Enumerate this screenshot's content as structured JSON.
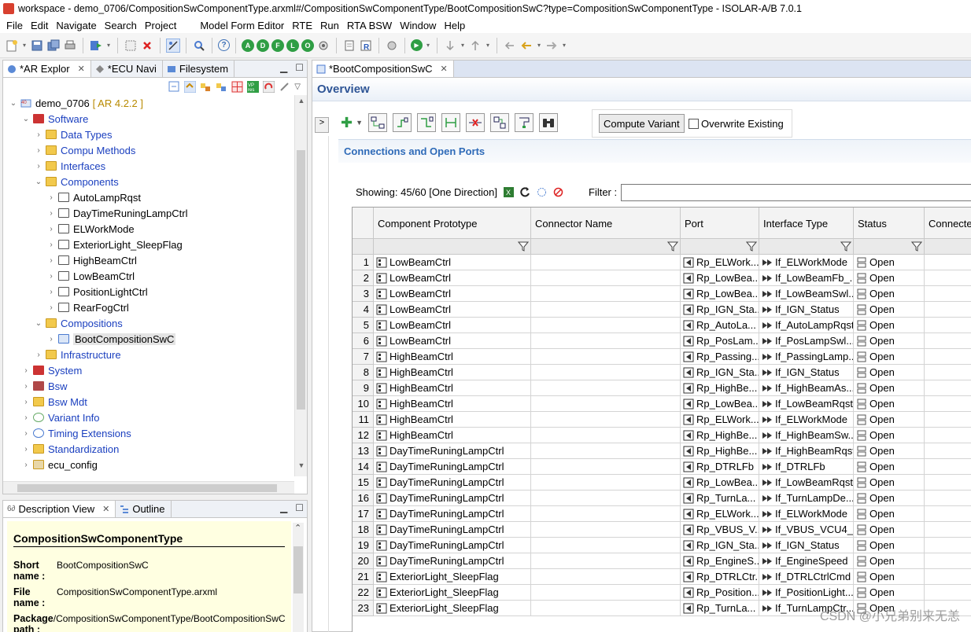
{
  "window_title": "workspace - demo_0706/CompositionSwComponentType.arxml#/CompositionSwComponentType/BootCompositionSwC?type=CompositionSwComponentType - ISOLAR-A/B 7.0.1",
  "menu": [
    "File",
    "Edit",
    "Navigate",
    "Search",
    "Project",
    "Model Form Editor",
    "RTE",
    "Run",
    "RTA BSW",
    "Window",
    "Help"
  ],
  "toolbar_letters": [
    "A",
    "D",
    "F",
    "L",
    "O"
  ],
  "left_tabs": [
    {
      "label": "*AR Explor",
      "close": "✕"
    },
    {
      "label": "*ECU Navi"
    },
    {
      "label": "Filesystem"
    }
  ],
  "tree": {
    "root": {
      "label": "demo_0706",
      "version": "[ AR 4.2.2 ]"
    },
    "items": [
      {
        "label": "Software"
      },
      {
        "label": "Data Types"
      },
      {
        "label": "Compu Methods"
      },
      {
        "label": "Interfaces"
      },
      {
        "label": "Components"
      },
      {
        "label": "AutoLampRqst"
      },
      {
        "label": "DayTimeRuningLampCtrl"
      },
      {
        "label": "ELWorkMode"
      },
      {
        "label": "ExteriorLight_SleepFlag"
      },
      {
        "label": "HighBeamCtrl"
      },
      {
        "label": "LowBeamCtrl"
      },
      {
        "label": "PositionLightCtrl"
      },
      {
        "label": "RearFogCtrl"
      },
      {
        "label": "Compositions"
      },
      {
        "label": "BootCompositionSwC"
      },
      {
        "label": "Infrastructure"
      },
      {
        "label": "System"
      },
      {
        "label": "Bsw"
      },
      {
        "label": "Bsw Mdt"
      },
      {
        "label": "Variant Info"
      },
      {
        "label": "Timing Extensions"
      },
      {
        "label": "Standardization"
      },
      {
        "label": "ecu_config"
      }
    ]
  },
  "desc_tabs": [
    {
      "label": "Description View",
      "close": "✕"
    },
    {
      "label": "Outline"
    }
  ],
  "description": {
    "title": "CompositionSwComponentType",
    "rows": [
      {
        "key": "Short name :",
        "value": "BootCompositionSwC"
      },
      {
        "key": "File name :",
        "value": "CompositionSwComponentType.arxml"
      },
      {
        "key": "Package path :",
        "value": "/CompositionSwComponentType/BootCompositionSwC"
      }
    ]
  },
  "editor": {
    "tab": {
      "label": "*BootCompositionSwC",
      "close": "✕"
    },
    "overview": "Overview",
    "collapse": ">",
    "compute_variant": "Compute Variant",
    "overwrite_existing": "Overwrite Existing",
    "section": "Connections and Open Ports",
    "showing": "Showing: 45/60 [One Direction]",
    "filter_label": "Filter :",
    "filter_value": ""
  },
  "table": {
    "columns": [
      "Component Prototype",
      "Connector Name",
      "Port",
      "Interface Type",
      "Status",
      "Connecte"
    ],
    "rows": [
      {
        "n": "1",
        "comp": "LowBeamCtrl",
        "conn": "",
        "port": "Rp_ELWork...",
        "iface": "If_ELWorkMode",
        "status": "Open"
      },
      {
        "n": "2",
        "comp": "LowBeamCtrl",
        "conn": "",
        "port": "Rp_LowBea...",
        "iface": "If_LowBeamFb_...",
        "status": "Open"
      },
      {
        "n": "3",
        "comp": "LowBeamCtrl",
        "conn": "",
        "port": "Rp_LowBea...",
        "iface": "If_LowBeamSwl...",
        "status": "Open"
      },
      {
        "n": "4",
        "comp": "LowBeamCtrl",
        "conn": "",
        "port": "Rp_IGN_Sta...",
        "iface": "If_IGN_Status",
        "status": "Open"
      },
      {
        "n": "5",
        "comp": "LowBeamCtrl",
        "conn": "",
        "port": "Rp_AutoLa...",
        "iface": "If_AutoLampRqst",
        "status": "Open"
      },
      {
        "n": "6",
        "comp": "LowBeamCtrl",
        "conn": "",
        "port": "Rp_PosLam...",
        "iface": "If_PosLampSwl...",
        "status": "Open"
      },
      {
        "n": "7",
        "comp": "HighBeamCtrl",
        "conn": "",
        "port": "Rp_Passing...",
        "iface": "If_PassingLamp...",
        "status": "Open"
      },
      {
        "n": "8",
        "comp": "HighBeamCtrl",
        "conn": "",
        "port": "Rp_IGN_Sta...",
        "iface": "If_IGN_Status",
        "status": "Open"
      },
      {
        "n": "9",
        "comp": "HighBeamCtrl",
        "conn": "",
        "port": "Rp_HighBe...",
        "iface": "If_HighBeamAs...",
        "status": "Open"
      },
      {
        "n": "10",
        "comp": "HighBeamCtrl",
        "conn": "",
        "port": "Rp_LowBea...",
        "iface": "If_LowBeamRqst",
        "status": "Open"
      },
      {
        "n": "11",
        "comp": "HighBeamCtrl",
        "conn": "",
        "port": "Rp_ELWork...",
        "iface": "If_ELWorkMode",
        "status": "Open"
      },
      {
        "n": "12",
        "comp": "HighBeamCtrl",
        "conn": "",
        "port": "Rp_HighBe...",
        "iface": "If_HighBeamSw...",
        "status": "Open"
      },
      {
        "n": "13",
        "comp": "DayTimeRuningLampCtrl",
        "conn": "",
        "port": "Rp_HighBe...",
        "iface": "If_HighBeamRqst",
        "status": "Open"
      },
      {
        "n": "14",
        "comp": "DayTimeRuningLampCtrl",
        "conn": "",
        "port": "Rp_DTRLFb",
        "iface": "If_DTRLFb",
        "status": "Open"
      },
      {
        "n": "15",
        "comp": "DayTimeRuningLampCtrl",
        "conn": "",
        "port": "Rp_LowBea...",
        "iface": "If_LowBeamRqst",
        "status": "Open"
      },
      {
        "n": "16",
        "comp": "DayTimeRuningLampCtrl",
        "conn": "",
        "port": "Rp_TurnLa...",
        "iface": "If_TurnLampDe...",
        "status": "Open"
      },
      {
        "n": "17",
        "comp": "DayTimeRuningLampCtrl",
        "conn": "",
        "port": "Rp_ELWork...",
        "iface": "If_ELWorkMode",
        "status": "Open"
      },
      {
        "n": "18",
        "comp": "DayTimeRuningLampCtrl",
        "conn": "",
        "port": "Rp_VBUS_V...",
        "iface": "If_VBUS_VCU4_...",
        "status": "Open"
      },
      {
        "n": "19",
        "comp": "DayTimeRuningLampCtrl",
        "conn": "",
        "port": "Rp_IGN_Sta...",
        "iface": "If_IGN_Status",
        "status": "Open"
      },
      {
        "n": "20",
        "comp": "DayTimeRuningLampCtrl",
        "conn": "",
        "port": "Rp_EngineS...",
        "iface": "If_EngineSpeed",
        "status": "Open"
      },
      {
        "n": "21",
        "comp": "ExteriorLight_SleepFlag",
        "conn": "",
        "port": "Rp_DTRLCtr...",
        "iface": "If_DTRLCtrlCmd",
        "status": "Open"
      },
      {
        "n": "22",
        "comp": "ExteriorLight_SleepFlag",
        "conn": "",
        "port": "Rp_Position...",
        "iface": "If_PositionLight...",
        "status": "Open"
      },
      {
        "n": "23",
        "comp": "ExteriorLight_SleepFlag",
        "conn": "",
        "port": "Rp_TurnLa...",
        "iface": "If_TurnLampCtr...",
        "status": "Open"
      }
    ]
  },
  "watermark": "CSDN @小兄弟别来无恙"
}
